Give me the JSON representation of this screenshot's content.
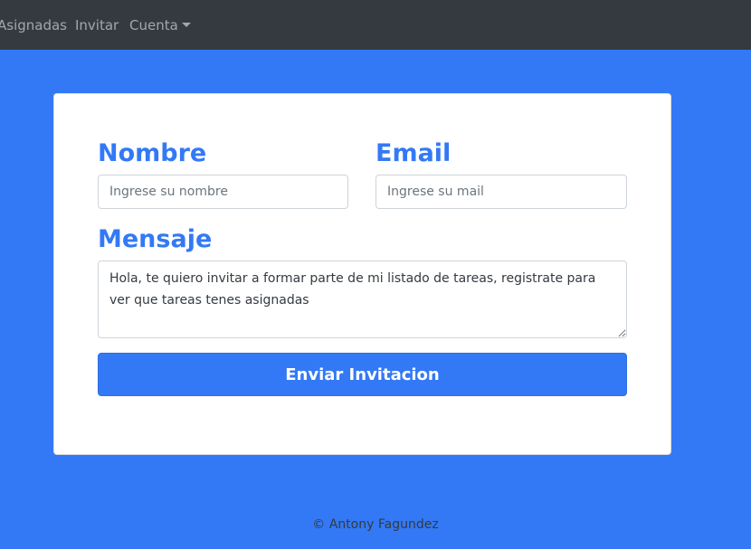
{
  "navbar": {
    "items": [
      {
        "label": "Asignadas"
      },
      {
        "label": "Invitar"
      },
      {
        "label": "Cuenta"
      }
    ]
  },
  "form": {
    "nombre_label": "Nombre",
    "nombre_placeholder": "Ingrese su nombre",
    "email_label": "Email",
    "email_placeholder": "Ingrese su mail",
    "mensaje_label": "Mensaje",
    "mensaje_value": "Hola, te quiero invitar a formar parte de mi listado de tareas, registrate para ver que tareas tenes asignadas",
    "submit_label": "Enviar Invitacion"
  },
  "footer": {
    "text": "© Antony Fagundez"
  },
  "colors": {
    "accent": "#3379f5",
    "navbar": "#343a40"
  }
}
